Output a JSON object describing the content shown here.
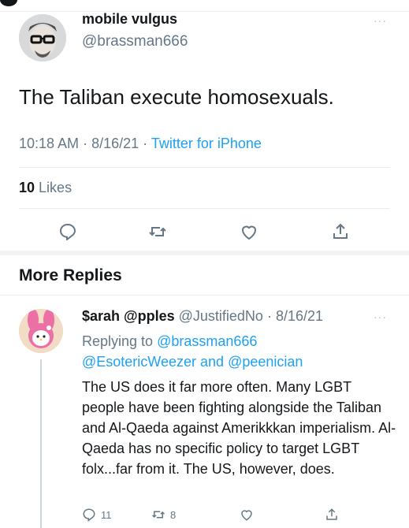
{
  "tweet": {
    "author_name": "mobile vulgus",
    "author_handle": "@brassman666",
    "text": "The Taliban execute homosexuals.",
    "time": "10:18 AM",
    "date": "8/16/21",
    "source": "Twitter for iPhone",
    "likes_count": "10",
    "likes_label": "Likes",
    "more_label": "···"
  },
  "section": {
    "title": "More Replies"
  },
  "reply": {
    "name": "$arah @pples",
    "handle": "@JustifiedNo",
    "date": "8/16/21",
    "replying_prefix": "Replying to",
    "mention1": "@brassman666",
    "mention2": "@EsotericWeezer",
    "mention_and": "and",
    "mention3": "@peenician",
    "text": "The US does it far more often. Many LGBT people have been fighting alongside the Taliban and Al-Qaeda against Amerikkkan imperialism. Al-Qaeda has no specific policy to target LGBT folx...far from it. The US, however, does.",
    "reply_count": "11",
    "retweet_count": "8",
    "more_label": "···"
  },
  "icons": {
    "reply": "reply-icon",
    "retweet": "retweet-icon",
    "like": "heart-icon",
    "share": "share-icon"
  },
  "colors": {
    "accent": "#1da1f2",
    "secondary_text": "#657786",
    "divider": "#e6ecf0"
  }
}
